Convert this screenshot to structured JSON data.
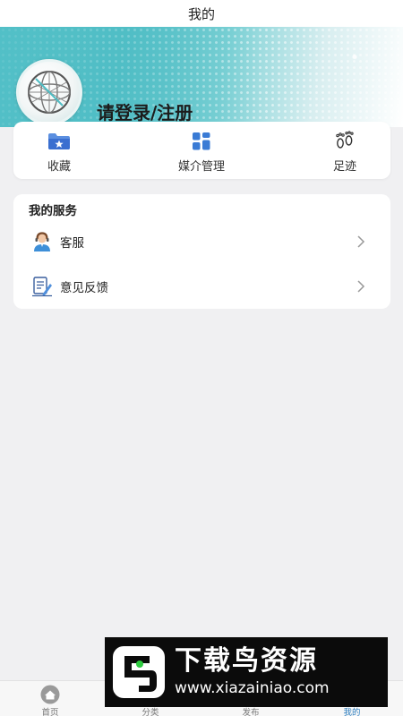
{
  "header": {
    "title": "我的"
  },
  "profile": {
    "login_label": "请登录/注册"
  },
  "quick_actions": [
    {
      "label": "收藏",
      "icon": "folder-star-icon"
    },
    {
      "label": "媒介管理",
      "icon": "grid-squares-icon"
    },
    {
      "label": "足迹",
      "icon": "footprints-icon"
    }
  ],
  "services": {
    "title": "我的服务",
    "items": [
      {
        "label": "客服",
        "icon": "customer-service-icon"
      },
      {
        "label": "意见反馈",
        "icon": "feedback-icon"
      }
    ]
  },
  "tabbar": {
    "items": [
      {
        "label": "首页",
        "icon": "home-icon"
      },
      {
        "label": "分类",
        "icon": "category-icon"
      },
      {
        "label": "发布",
        "icon": "publish-icon"
      },
      {
        "label": "我的",
        "icon": "profile-icon",
        "active": true
      }
    ],
    "active_color": "#2f7fc0"
  },
  "watermark": {
    "brand": "下载鸟资源",
    "url": "www.xiazainiao.com"
  },
  "colors": {
    "accent": "#4fbdc4",
    "icon_blue": "#3a7bd5"
  }
}
